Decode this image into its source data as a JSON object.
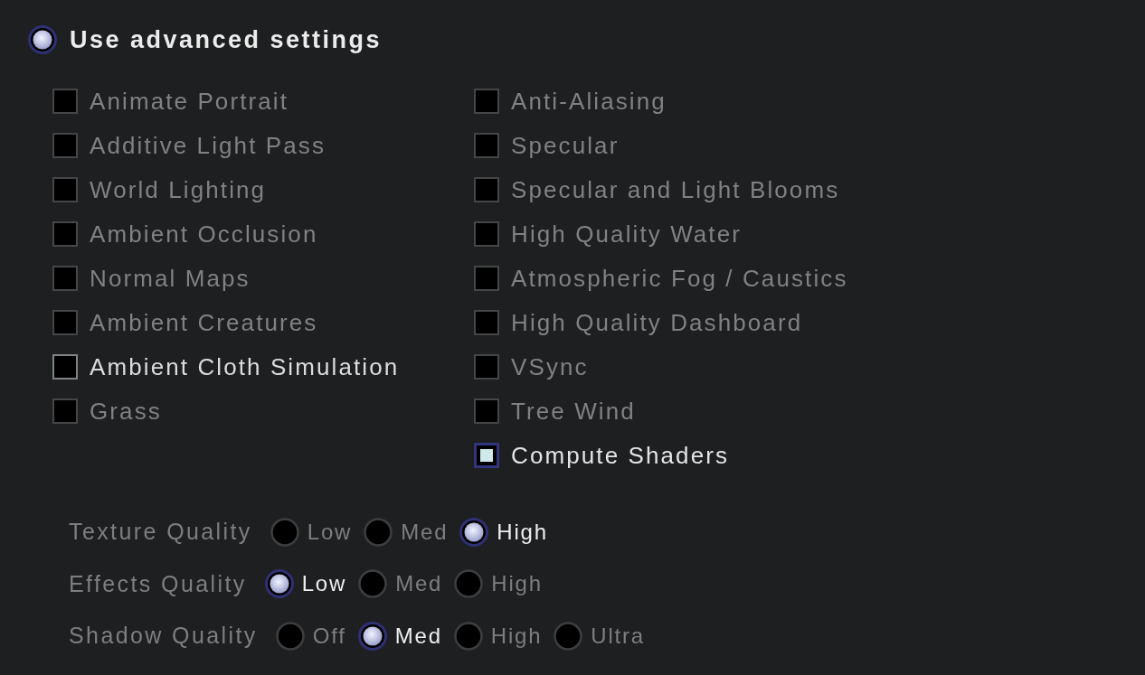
{
  "advanced_settings": {
    "label": "Use advanced settings",
    "selected": true
  },
  "checkbox_columns": [
    {
      "items": [
        {
          "label": "Animate Portrait",
          "checked": false,
          "hovered": false
        },
        {
          "label": "Additive Light Pass",
          "checked": false,
          "hovered": false
        },
        {
          "label": "World Lighting",
          "checked": false,
          "hovered": false
        },
        {
          "label": "Ambient Occlusion",
          "checked": false,
          "hovered": false
        },
        {
          "label": "Normal Maps",
          "checked": false,
          "hovered": false
        },
        {
          "label": "Ambient Creatures",
          "checked": false,
          "hovered": false
        },
        {
          "label": "Ambient Cloth Simulation",
          "checked": false,
          "hovered": true
        },
        {
          "label": "Grass",
          "checked": false,
          "hovered": false
        }
      ]
    },
    {
      "items": [
        {
          "label": "Anti-Aliasing",
          "checked": false,
          "hovered": false
        },
        {
          "label": "Specular",
          "checked": false,
          "hovered": false
        },
        {
          "label": "Specular and Light Blooms",
          "checked": false,
          "hovered": false
        },
        {
          "label": "High Quality Water",
          "checked": false,
          "hovered": false
        },
        {
          "label": "Atmospheric Fog / Caustics",
          "checked": false,
          "hovered": false
        },
        {
          "label": "High Quality Dashboard",
          "checked": false,
          "hovered": false
        },
        {
          "label": "VSync",
          "checked": false,
          "hovered": false
        },
        {
          "label": "Tree Wind",
          "checked": false,
          "hovered": false
        },
        {
          "label": "Compute Shaders",
          "checked": true,
          "hovered": false
        }
      ]
    }
  ],
  "quality_settings": [
    {
      "label": "Texture Quality",
      "options": [
        {
          "label": "Low",
          "selected": false
        },
        {
          "label": "Med",
          "selected": false
        },
        {
          "label": "High",
          "selected": true
        }
      ]
    },
    {
      "label": "Effects Quality",
      "options": [
        {
          "label": "Low",
          "selected": true
        },
        {
          "label": "Med",
          "selected": false
        },
        {
          "label": "High",
          "selected": false
        }
      ]
    },
    {
      "label": "Shadow Quality",
      "options": [
        {
          "label": "Off",
          "selected": false
        },
        {
          "label": "Med",
          "selected": true
        },
        {
          "label": "High",
          "selected": false
        },
        {
          "label": "Ultra",
          "selected": false
        }
      ]
    }
  ]
}
